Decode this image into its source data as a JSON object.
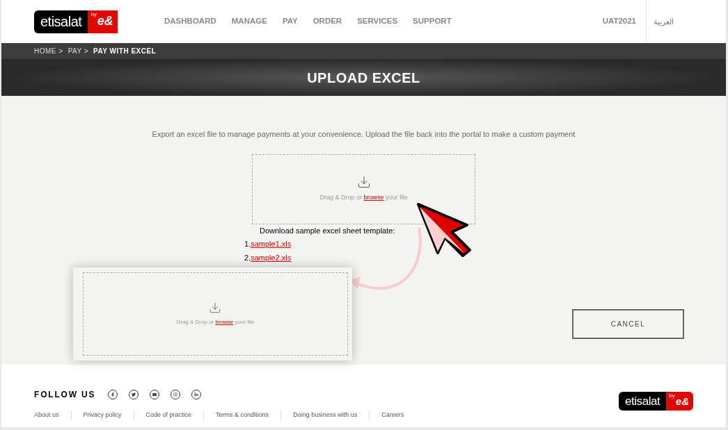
{
  "header": {
    "logo": {
      "name": "etisalat",
      "by": "by",
      "mark": "e&"
    },
    "nav": [
      {
        "label": "DASHBOARD",
        "selected": false
      },
      {
        "label": "MANAGE",
        "selected": false
      },
      {
        "label": "PAY",
        "selected": false
      },
      {
        "label": "ORDER",
        "selected": false
      },
      {
        "label": "SERVICES",
        "selected": false
      },
      {
        "label": "SUPPORT",
        "selected": false
      }
    ],
    "user": "UAT2021",
    "language": "العربية"
  },
  "breadcrumb": [
    "HOME >",
    "PAY >",
    "PAY WITH EXCEL"
  ],
  "page_title": "UPLOAD EXCEL",
  "description": "Export an excel file to manage payments at your convenience. Upload the file back into the portal to make a custom payment",
  "dropzone": {
    "text_before": "Drag & Drop or",
    "link": "browse",
    "text_after": "your file"
  },
  "samples": {
    "heading": "Download sample excel sheet template:",
    "files": [
      {
        "number": "1.",
        "name": "sample1.xls"
      },
      {
        "number": "2.",
        "name": "sample2.xls"
      }
    ]
  },
  "cancel_button": "CANCEL",
  "callout": {
    "text_before": "Drag & Drop or",
    "link": "browse",
    "text_after": "your file"
  },
  "footer": {
    "follow_us": "FOLLOW US",
    "social": [
      {
        "kind": "facebook"
      },
      {
        "kind": "twitter"
      },
      {
        "kind": "youtube"
      },
      {
        "kind": "instagram"
      },
      {
        "kind": "linkedin"
      }
    ],
    "links": [
      "About us",
      "Privacy policy",
      "Code of practice",
      "Terms & conditions",
      "Doing business with us",
      "Careers"
    ],
    "logo": {
      "name": "etisalat",
      "by": "by",
      "mark": "e&"
    }
  }
}
